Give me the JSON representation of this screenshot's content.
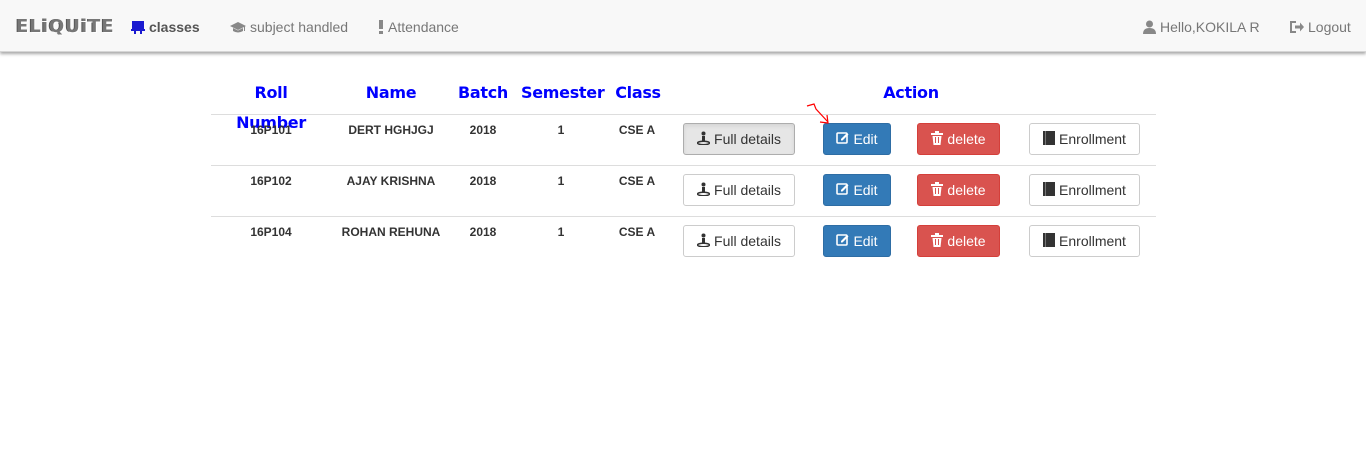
{
  "navbar": {
    "brand": "ELiQUiTE",
    "items": [
      {
        "label": "classes",
        "icon": "chalkboard-icon"
      },
      {
        "label": "subject handled",
        "icon": "graduation-cap-icon"
      },
      {
        "label": "Attendance",
        "icon": "exclamation-icon"
      }
    ],
    "user_greeting": "Hello,KOKILA R",
    "logout_label": "Logout"
  },
  "table": {
    "headers": [
      "Roll Number",
      "Name",
      "Batch",
      "Semester",
      "Class",
      "Action"
    ],
    "buttons": {
      "full_details": "Full details",
      "edit": "Edit",
      "delete": "delete",
      "enrollment": "Enrollment"
    },
    "rows": [
      {
        "roll": "16P101",
        "name": "DERT HGHJGJ",
        "batch": "2018",
        "semester": "1",
        "class": "CSE A"
      },
      {
        "roll": "16P102",
        "name": "AJAY KRISHNA",
        "batch": "2018",
        "semester": "1",
        "class": "CSE A"
      },
      {
        "roll": "16P104",
        "name": "ROHAN REHUNA",
        "batch": "2018",
        "semester": "1",
        "class": "CSE A"
      }
    ]
  },
  "colors": {
    "header_text": "#0000ff",
    "primary": "#337ab7",
    "danger": "#d9534f",
    "annotation": "#ff0000"
  }
}
